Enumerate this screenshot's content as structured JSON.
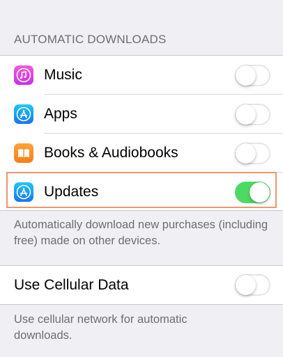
{
  "section_header": "AUTOMATIC DOWNLOADS",
  "rows": [
    {
      "label": "Music",
      "icon": "music-icon",
      "toggle": false
    },
    {
      "label": "Apps",
      "icon": "app-store-icon",
      "toggle": false
    },
    {
      "label": "Books & Audiobooks",
      "icon": "books-icon",
      "toggle": false
    },
    {
      "label": "Updates",
      "icon": "app-store-icon",
      "toggle": true,
      "highlighted": true
    }
  ],
  "auto_download_footer": "Automatically download new purchases (including free) made on other devices.",
  "cellular": {
    "label": "Use Cellular Data",
    "toggle": false
  },
  "cellular_footer": "Use cellular network for automatic downloads.",
  "colors": {
    "toggle_on": "#4cd964",
    "toggle_off_border": "#e5e5ea",
    "background": "#efeff4",
    "highlight": "#f0956c"
  }
}
